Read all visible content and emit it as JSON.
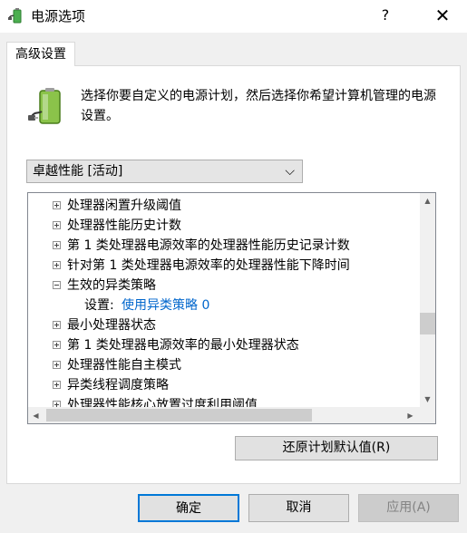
{
  "window": {
    "title": "电源选项",
    "help_label": "?",
    "close_label": "✕"
  },
  "tab": {
    "label": "高级设置"
  },
  "description": "选择你要自定义的电源计划，然后选择你希望计算机管理的电源设置。",
  "plan_select": {
    "value": "卓越性能 [活动]",
    "chevron": "⌵"
  },
  "tree": {
    "items": [
      {
        "label": "处理器闲置升级阈值",
        "expander": "plus"
      },
      {
        "label": "处理器性能历史计数",
        "expander": "plus"
      },
      {
        "label": "第 1 类处理器电源效率的处理器性能历史记录计数",
        "expander": "plus"
      },
      {
        "label": "针对第 1 类处理器电源效率的处理器性能下降时间",
        "expander": "plus"
      },
      {
        "label": "生效的异类策略",
        "expander": "minus"
      },
      {
        "label": "最小处理器状态",
        "expander": "plus"
      },
      {
        "label": "第 1 类处理器电源效率的最小处理器状态",
        "expander": "plus"
      },
      {
        "label": "处理器性能自主模式",
        "expander": "plus"
      },
      {
        "label": "异类线程调度策略",
        "expander": "plus"
      },
      {
        "label": "处理器性能核心放置过度利用阈值",
        "expander": "plus"
      }
    ],
    "setting": {
      "label": "设置:",
      "value": "使用异类策略 0"
    },
    "scroll_up": "▲",
    "scroll_down": "▼",
    "scroll_left": "◀",
    "scroll_right": "▶"
  },
  "buttons": {
    "restore": "还原计划默认值(R)",
    "ok": "确定",
    "cancel": "取消",
    "apply": "应用(A)"
  },
  "colors": {
    "link": "#0066cc",
    "accent": "#0078d7"
  }
}
